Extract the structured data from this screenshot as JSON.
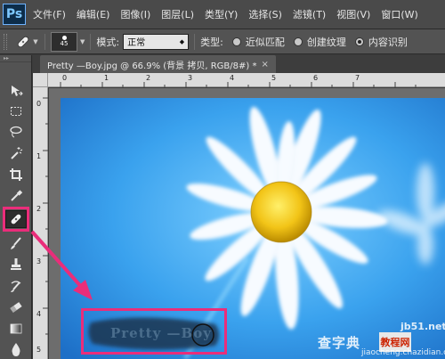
{
  "app": {
    "logo": "Ps",
    "menu": [
      "文件(F)",
      "编辑(E)",
      "图像(I)",
      "图层(L)",
      "类型(Y)",
      "选择(S)",
      "滤镜(T)",
      "视图(V)",
      "窗口(W)"
    ]
  },
  "options": {
    "brush_size": "45",
    "mode_label": "模式:",
    "mode_value": "正常",
    "type_label": "类型:",
    "radio_labels": [
      "近似匹配",
      "创建纹理",
      "内容识别"
    ],
    "radio_selected": 2
  },
  "document": {
    "tab_title": "Pretty —Boy.jpg @ 66.9% (背景 拷贝, RGB/8#) *",
    "close": "×",
    "ruler_top_labels": [
      "0",
      "1",
      "2",
      "3",
      "4",
      "5",
      "6",
      "7"
    ],
    "ruler_left_labels": [
      "0",
      "1",
      "2",
      "3",
      "4",
      "5"
    ],
    "canvas_text": "Pretty —Boy"
  },
  "watermarks": {
    "site": "jb51.net",
    "brand_a": "查字典",
    "brand_box": "教程网",
    "domain": "jiaocheng.chazidian.com"
  },
  "colors": {
    "accent_annotation": "#ea2d7a",
    "sky": "#3aa2ee",
    "petal": "#ffffff",
    "center": "#f2c417"
  },
  "icons": [
    "move-icon",
    "marquee-icon",
    "lasso-icon",
    "magic-wand-icon",
    "crop-icon",
    "eyedropper-icon",
    "spot-healing-brush-icon",
    "brush-icon",
    "clone-stamp-icon",
    "history-brush-icon",
    "eraser-icon",
    "gradient-icon",
    "blur-icon"
  ]
}
